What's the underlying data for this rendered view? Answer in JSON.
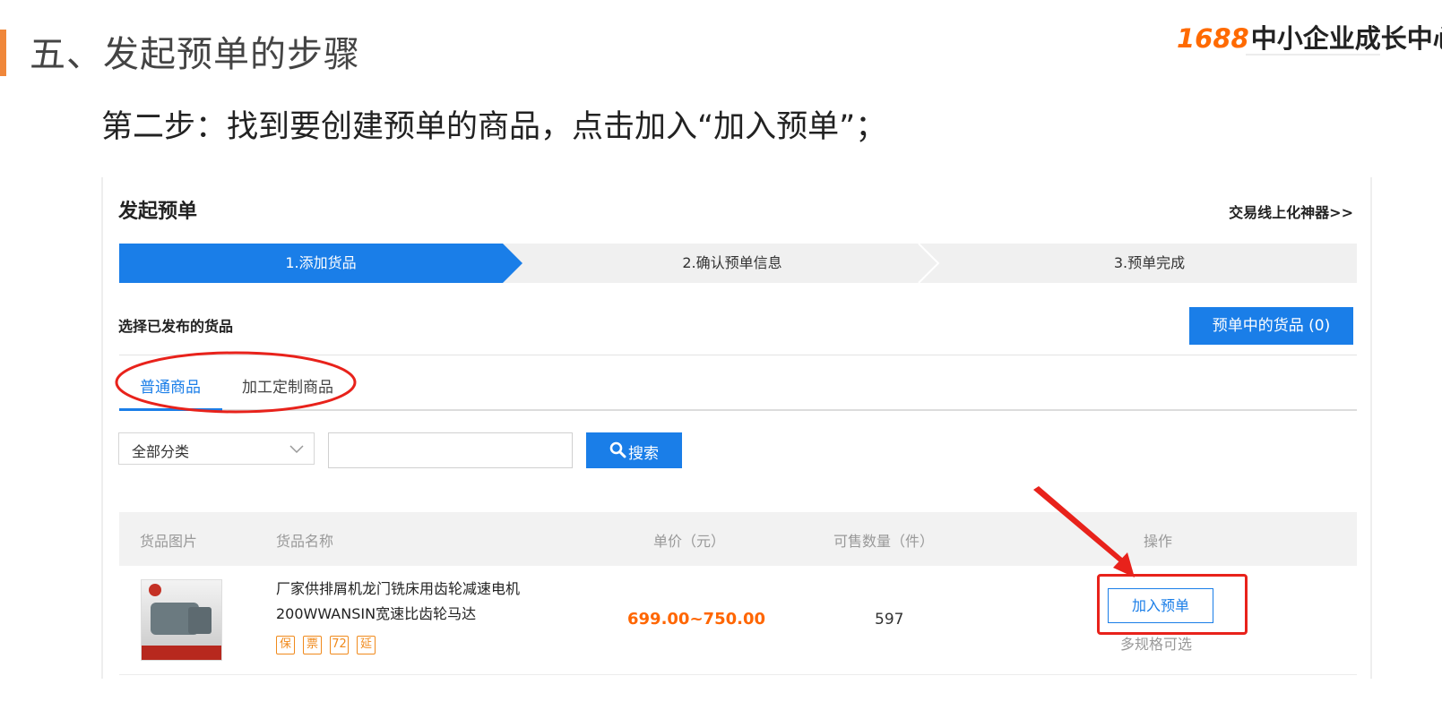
{
  "slide": {
    "title": "五、发起预单的步骤",
    "brand_number": "1688",
    "brand_name": "中小企业成长中心",
    "step_text": "第二步：找到要创建预单的商品，点击加入“加入预单”；",
    "accent_color": "#f0873a"
  },
  "panel": {
    "title": "发起预单",
    "top_link": "交易线上化神器>>",
    "steps": [
      "1.添加货品",
      "2.确认预单信息",
      "3.预单完成"
    ],
    "active_step": 1,
    "section_title": "选择已发布的货品",
    "cart_button": "预单中的货品 (0)",
    "tabs": [
      "普通商品",
      "加工定制商品"
    ],
    "active_tab": 0,
    "category_select": "全部分类",
    "search_value": "",
    "search_button": "搜索",
    "table_headers": [
      "货品图片",
      "货品名称",
      "单价（元）",
      "可售数量（件）",
      "操作"
    ],
    "product": {
      "name": "厂家供排屑机龙门铣床用齿轮减速电机 200WWANSIN宽速比齿轮马达",
      "badges": [
        "保",
        "票",
        "72",
        "延"
      ],
      "price": "699.00~750.00",
      "quantity": "597",
      "action": "加入预单",
      "note": "多规格可选"
    },
    "primary_color": "#1a7ee8",
    "price_color": "#ff6600",
    "annotation_color": "#e8221b"
  }
}
